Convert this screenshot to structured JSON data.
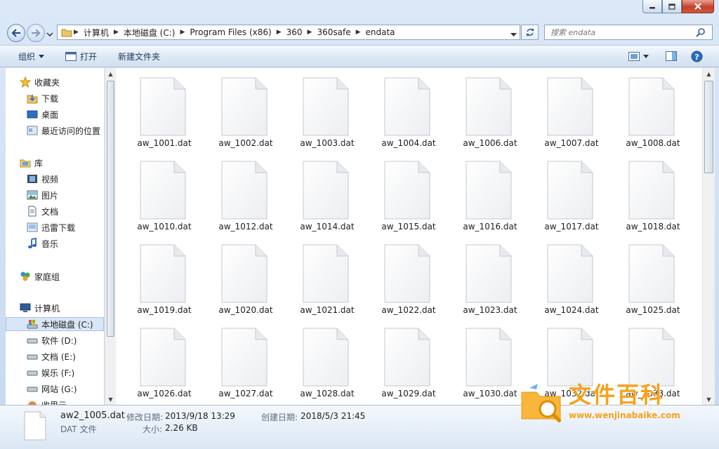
{
  "window": {
    "caption_buttons": {
      "minimize": "minimize-icon",
      "maximize": "maximize-icon",
      "close": "close-icon"
    }
  },
  "address": {
    "crumbs": [
      "计算机",
      "本地磁盘 (C:)",
      "Program Files (x86)",
      "360",
      "360safe",
      "endata"
    ]
  },
  "search": {
    "placeholder": "搜索 endata"
  },
  "toolbar": {
    "organize_label": "组织",
    "open_label": "打开",
    "new_folder_label": "新建文件夹"
  },
  "nav": {
    "favorites_header": "收藏夹",
    "favorites": [
      "下载",
      "桌面",
      "最近访问的位置"
    ],
    "libraries_header": "库",
    "libraries": [
      "视频",
      "图片",
      "文档",
      "迅雷下载",
      "音乐"
    ],
    "homegroup": "家庭组",
    "computer_header": "计算机",
    "drives": [
      "本地磁盘 (C:)",
      "软件 (D:)",
      "文档 (E:)",
      "娱乐 (F:)",
      "网站 (G:)",
      "收里云"
    ]
  },
  "files": [
    "aw_1001.dat",
    "aw_1002.dat",
    "aw_1003.dat",
    "aw_1004.dat",
    "aw_1006.dat",
    "aw_1007.dat",
    "aw_1008.dat",
    "aw_1010.dat",
    "aw_1012.dat",
    "aw_1014.dat",
    "aw_1015.dat",
    "aw_1016.dat",
    "aw_1017.dat",
    "aw_1018.dat",
    "aw_1019.dat",
    "aw_1020.dat",
    "aw_1021.dat",
    "aw_1022.dat",
    "aw_1023.dat",
    "aw_1024.dat",
    "aw_1025.dat",
    "aw_1026.dat",
    "aw_1027.dat",
    "aw_1028.dat",
    "aw_1029.dat",
    "aw_1030.dat",
    "aw_1032.dat",
    "aw_1033.dat"
  ],
  "details": {
    "filename": "aw2_1005.dat",
    "filetype": "DAT 文件",
    "modified_label": "修改日期:",
    "modified_value": "2013/9/18 13:29",
    "created_label": "创建日期:",
    "created_value": "2018/5/3 21:45",
    "size_label": "大小:",
    "size_value": "2.26 KB"
  },
  "watermark": {
    "title": "文件百科",
    "url": "www.wenjinabaike.com"
  }
}
